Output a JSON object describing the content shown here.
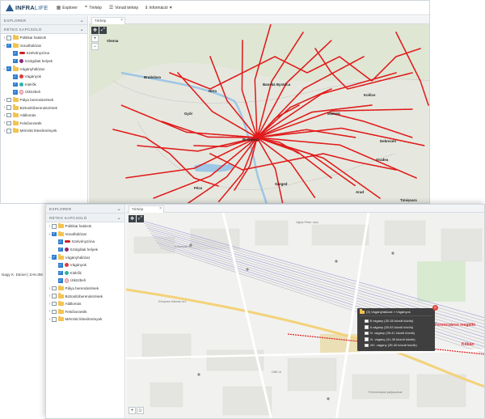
{
  "app": {
    "logo_brand": "INFRA",
    "logo_suffix": "LIFE",
    "nav": [
      {
        "icon": "explorer-icon",
        "label": "Explorer"
      },
      {
        "icon": "map-pin-icon",
        "label": "Térkép"
      },
      {
        "icon": "route-icon",
        "label": "Vonali térkép"
      },
      {
        "icon": "info-icon",
        "label": "Információ"
      }
    ]
  },
  "explorer": {
    "header": "EXPLORER",
    "layers_header": "RÉTEG KAPCSOLÓ",
    "tree": [
      {
        "label": "Politikai határok",
        "level": 0,
        "checked": false,
        "expand": "›",
        "symbol": "folder"
      },
      {
        "label": "Vonalhálózat",
        "level": 0,
        "checked": true,
        "expand": "⌄",
        "symbol": "folder"
      },
      {
        "label": "Szelvényzóna",
        "level": 1,
        "checked": true,
        "expand": "",
        "symbol": "line-red"
      },
      {
        "label": "Szolgálati helyek",
        "level": 1,
        "checked": true,
        "expand": "",
        "symbol": "dot-purple"
      },
      {
        "label": "Vágányhálózat",
        "level": 0,
        "checked": true,
        "expand": "⌄",
        "symbol": "folder"
      },
      {
        "label": "Vágányok",
        "level": 1,
        "checked": true,
        "expand": "",
        "symbol": "dot-red"
      },
      {
        "label": "Kitérők",
        "level": 1,
        "checked": true,
        "expand": "",
        "symbol": "dot-teal"
      },
      {
        "label": "Útközbeli",
        "level": 1,
        "checked": true,
        "expand": "",
        "symbol": "dot-pink"
      },
      {
        "label": "Pálya berendezések",
        "level": 0,
        "checked": false,
        "expand": "›",
        "symbol": "folder"
      },
      {
        "label": "Biztosítóberendezések",
        "level": 0,
        "checked": false,
        "expand": "›",
        "symbol": "folder"
      },
      {
        "label": "Alállomás",
        "level": 0,
        "checked": false,
        "expand": "›",
        "symbol": "folder"
      },
      {
        "label": "Felsővezeték",
        "level": 0,
        "checked": false,
        "expand": "›",
        "symbol": "folder"
      },
      {
        "label": "Mérnöki létesítmények",
        "level": 0,
        "checked": false,
        "expand": "›",
        "symbol": "folder"
      }
    ]
  },
  "map_back": {
    "tab_label": "Térkép",
    "cities": [
      "Vienna",
      "Bratislava",
      "Nitra",
      "Banská Bystrica",
      "Košice",
      "Miskolc",
      "Debrecen",
      "Győr",
      "Budapest",
      "Szeged",
      "Pécs",
      "Oradea",
      "Arad",
      "Timișoara"
    ]
  },
  "map_front": {
    "tab_label": "Térkép",
    "popup": {
      "title": "(3) Vágányhálózat » Vágányok",
      "items": [
        "B vágány (30-35 közúti közök)",
        "A vágány (35-53 közúti közök)",
        "IV. vágány (39-41 közúti közök)",
        "VI. vágány (31-35 közúti közök)",
        "VIII. vágány (39-40 közúti közök)"
      ]
    },
    "labels": {
      "station": "Ferencváros megálló",
      "edge": "Kőbán"
    },
    "streets": [
      "Kőbányai út",
      "Vajda Péter utca",
      "Könyves Kálmán krt.",
      "Üllői út",
      "Ferencvárosi pályaudvar"
    ]
  },
  "user": {
    "name": "Nagy K. Dániel | ZAKJIM"
  },
  "colors": {
    "track_red": "#e01a1a",
    "brand_blue": "#2a5d8f",
    "check_blue": "#2f7fd0"
  }
}
